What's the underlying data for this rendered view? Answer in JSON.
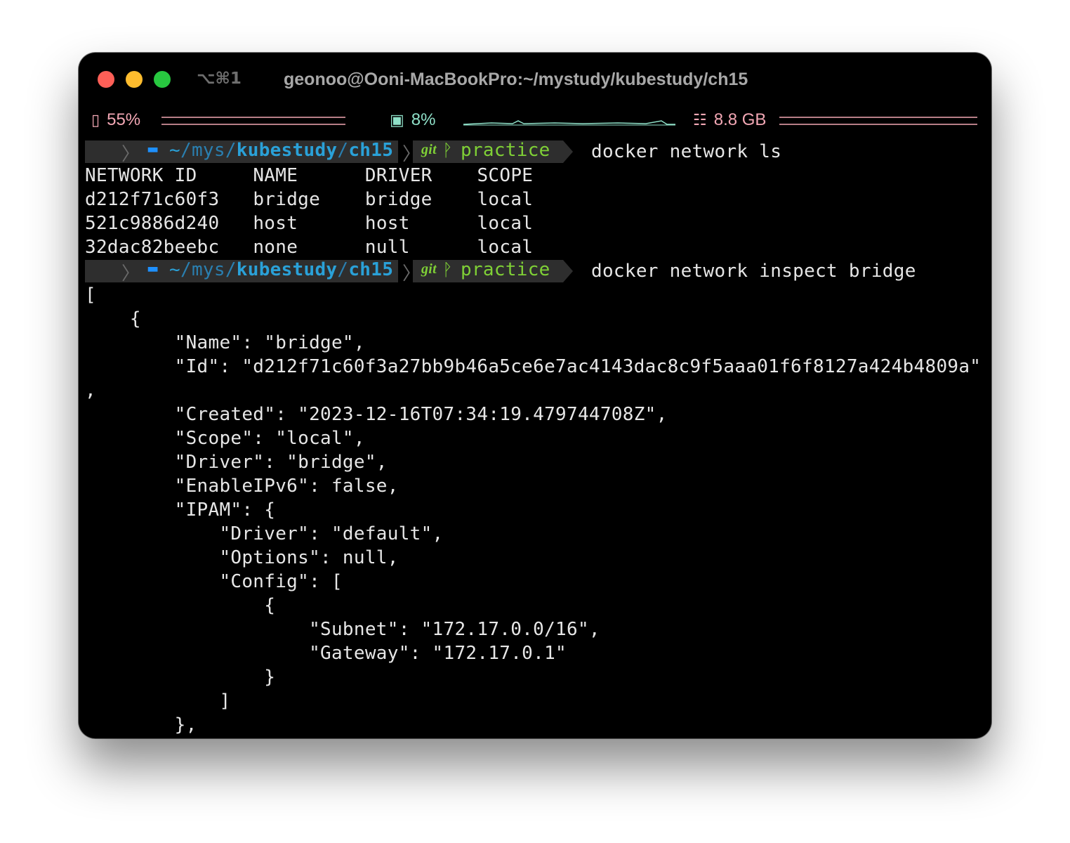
{
  "window": {
    "shortcut": "⌥⌘1",
    "title": "geonoo@Ooni-MacBookPro:~/mystudy/kubestudy/ch15"
  },
  "status": {
    "battery": {
      "icon": "battery-icon",
      "glyph": "▯",
      "value": "55%",
      "color": "#f2a7b4"
    },
    "cpu": {
      "icon": "cpu-icon",
      "glyph": "▣",
      "value": "8%",
      "color": "#8fe0c8"
    },
    "memory": {
      "icon": "memory-icon",
      "glyph": "☷",
      "value": "8.8 GB",
      "color": "#f2a7b4"
    }
  },
  "prompt": {
    "apple": "",
    "path_tilde": "~",
    "path_slash1": "/",
    "path_mys": "mys",
    "path_slash2": "/",
    "path_kubestudy": "kubestudy",
    "path_slash3": "/",
    "path_ch15": "ch15",
    "git_label": "git",
    "branch_glyph": "ᚹ",
    "branch": "practice"
  },
  "commands": [
    "docker network ls",
    "docker network inspect bridge"
  ],
  "network_table": {
    "headers": [
      "NETWORK ID",
      "NAME",
      "DRIVER",
      "SCOPE"
    ],
    "rows": [
      [
        "d212f71c60f3",
        "bridge",
        "bridge",
        "local"
      ],
      [
        "521c9886d240",
        "host",
        "host",
        "local"
      ],
      [
        "32dac82beebc",
        "none",
        "null",
        "local"
      ]
    ]
  },
  "inspect_output": [
    "[",
    "    {",
    "        \"Name\": \"bridge\",",
    "        \"Id\": \"d212f71c60f3a27bb9b46a5ce6e7ac4143dac8c9f5aaa01f6f8127a424b4809a\"",
    ",",
    "        \"Created\": \"2023-12-16T07:34:19.479744708Z\",",
    "        \"Scope\": \"local\",",
    "        \"Driver\": \"bridge\",",
    "        \"EnableIPv6\": false,",
    "        \"IPAM\": {",
    "            \"Driver\": \"default\",",
    "            \"Options\": null,",
    "            \"Config\": [",
    "                {",
    "                    \"Subnet\": \"172.17.0.0/16\",",
    "                    \"Gateway\": \"172.17.0.1\"",
    "                }",
    "            ]",
    "        },"
  ]
}
